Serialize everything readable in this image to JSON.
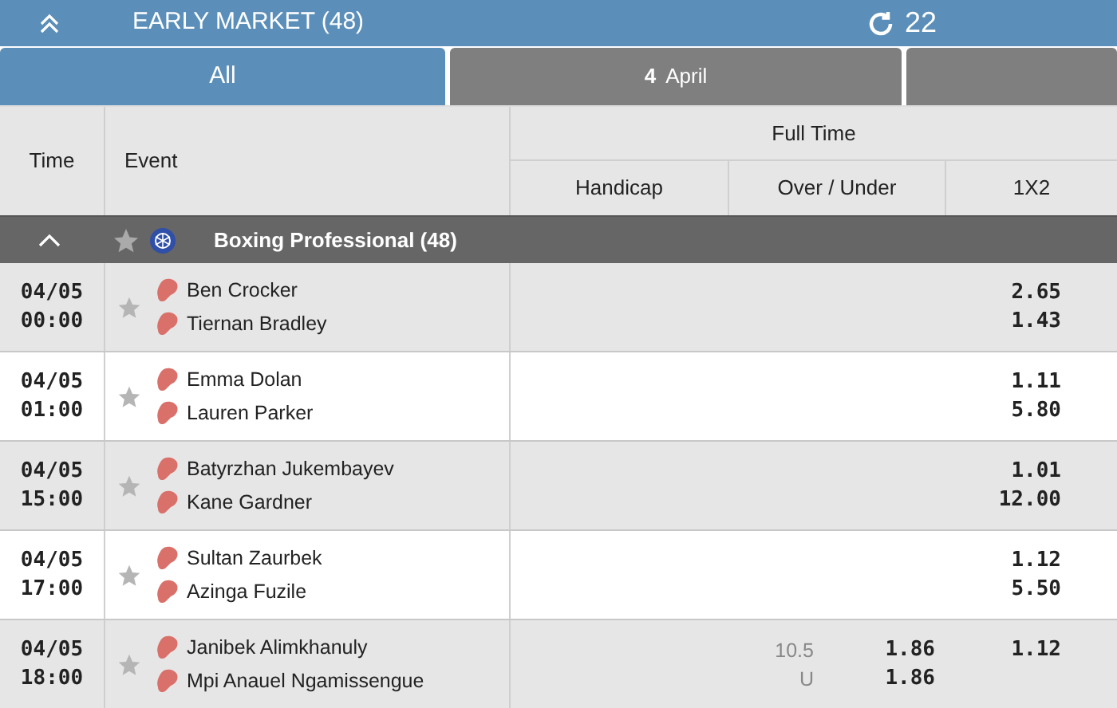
{
  "header": {
    "title": "EARLY MARKET (48)",
    "refresh_count": "22"
  },
  "tabs": [
    {
      "label": "All",
      "selected": true
    },
    {
      "day": "4",
      "label": "April",
      "selected": false
    },
    {
      "selected": false
    }
  ],
  "table": {
    "columns": {
      "time": "Time",
      "event": "Event",
      "group": "Full Time",
      "markets": [
        "Handicap",
        "Over / Under",
        "1X2"
      ]
    },
    "league": {
      "name": "Boxing Professional (48)",
      "expanded": true
    },
    "rows": [
      {
        "date": "04/05",
        "time": "00:00",
        "teams": [
          "Ben Crocker",
          "Tiernan Bradley"
        ],
        "one_x_two": [
          "2.65",
          "1.43"
        ]
      },
      {
        "date": "04/05",
        "time": "01:00",
        "teams": [
          "Emma Dolan",
          "Lauren Parker"
        ],
        "one_x_two": [
          "1.11",
          "5.80"
        ]
      },
      {
        "date": "04/05",
        "time": "15:00",
        "teams": [
          "Batyrzhan Jukembayev",
          "Kane Gardner"
        ],
        "one_x_two": [
          "1.01",
          "12.00"
        ]
      },
      {
        "date": "04/05",
        "time": "17:00",
        "teams": [
          "Sultan Zaurbek",
          "Azinga Fuzile"
        ],
        "one_x_two": [
          "1.12",
          "5.50"
        ]
      },
      {
        "date": "04/05",
        "time": "18:00",
        "teams": [
          "Janibek Alimkhanuly",
          "Mpi Anauel Ngamissengue"
        ],
        "over_under": {
          "labels": [
            "10.5",
            "U"
          ],
          "odds": [
            "1.86",
            "1.86"
          ]
        },
        "one_x_two": [
          "1.12"
        ]
      }
    ]
  }
}
